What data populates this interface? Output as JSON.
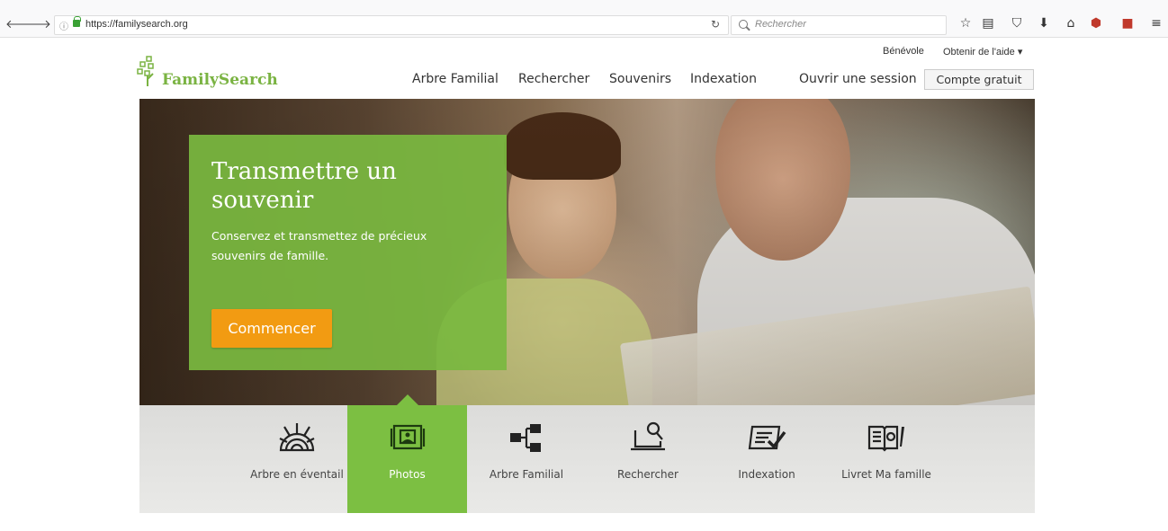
{
  "browser": {
    "url": "https://familysearch.org",
    "search_placeholder": "Rechercher"
  },
  "header": {
    "top_links": {
      "volunteer": "Bénévole",
      "help": "Obtenir de l'aide ▾"
    },
    "logo": "FamilySearch",
    "nav": [
      "Arbre Familial",
      "Rechercher",
      "Souvenirs",
      "Indexation"
    ],
    "signin": "Ouvrir une session",
    "signup": "Compte gratuit"
  },
  "hero": {
    "title": "Transmettre un souvenir",
    "subtitle": "Conservez et transmettez de précieux souvenirs de famille.",
    "cta": "Commencer"
  },
  "features": {
    "tabs": [
      {
        "label": "Arbre en éventail",
        "icon": "fan-chart-icon",
        "active": false
      },
      {
        "label": "Photos",
        "icon": "photos-icon",
        "active": true
      },
      {
        "label": "Arbre Familial",
        "icon": "family-tree-icon",
        "active": false
      },
      {
        "label": "Rechercher",
        "icon": "laptop-search-icon",
        "active": false
      },
      {
        "label": "Indexation",
        "icon": "indexing-icon",
        "active": false
      },
      {
        "label": "Livret Ma famille",
        "icon": "booklet-icon",
        "active": false
      }
    ]
  },
  "colors": {
    "brand_green": "#7ab342",
    "cta_orange": "#f29b12",
    "panel_green": "#7cbf42"
  }
}
